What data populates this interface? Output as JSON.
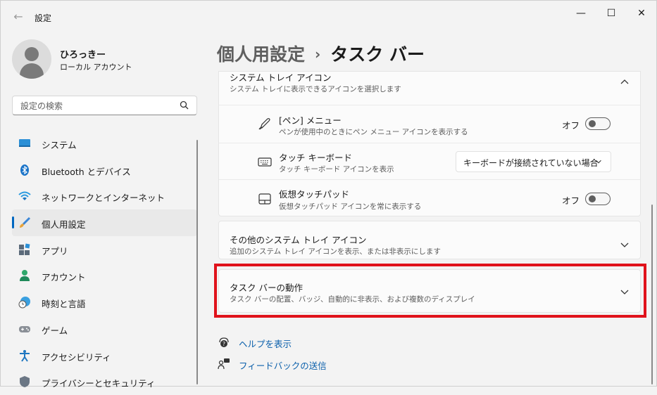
{
  "window": {
    "title": "設定",
    "back_glyph": "←",
    "minimize_glyph": "—",
    "maximize_glyph": "☐",
    "close_glyph": "✕"
  },
  "profile": {
    "name": "ひろっきー",
    "account_type": "ローカル アカウント"
  },
  "search": {
    "placeholder": "設定の検索"
  },
  "nav": {
    "items": [
      {
        "label": "システム",
        "icon": "system-icon"
      },
      {
        "label": "Bluetooth とデバイス",
        "icon": "bluetooth-icon"
      },
      {
        "label": "ネットワークとインターネット",
        "icon": "wifi-icon"
      },
      {
        "label": "個人用設定",
        "icon": "brush-icon",
        "selected": true
      },
      {
        "label": "アプリ",
        "icon": "apps-icon"
      },
      {
        "label": "アカウント",
        "icon": "account-icon"
      },
      {
        "label": "時刻と言語",
        "icon": "clock-globe-icon"
      },
      {
        "label": "ゲーム",
        "icon": "gamepad-icon"
      },
      {
        "label": "アクセシビリティ",
        "icon": "accessibility-icon"
      },
      {
        "label": "プライバシーとセキュリティ",
        "icon": "shield-icon"
      }
    ]
  },
  "header": {
    "parent": "個人用設定",
    "separator": "›",
    "current": "タスク バー"
  },
  "system_tray": {
    "title": "システム トレイ アイコン",
    "subtitle": "システム トレイに表示できるアイコンを選択します",
    "rows": [
      {
        "title": "[ペン] メニュー",
        "subtitle": "ペンが使用中のときにペン メニュー アイコンを表示する",
        "control": "toggle",
        "state_label": "オフ",
        "icon": "pen-icon"
      },
      {
        "title": "タッチ キーボード",
        "subtitle": "タッチ キーボード アイコンを表示",
        "control": "dropdown",
        "value": "キーボードが接続されていない場合",
        "icon": "keyboard-icon"
      },
      {
        "title": "仮想タッチパッド",
        "subtitle": "仮想タッチパッド アイコンを常に表示する",
        "control": "toggle",
        "state_label": "オフ",
        "icon": "touchpad-icon"
      }
    ]
  },
  "other_tray": {
    "title": "その他のシステム トレイ アイコン",
    "subtitle": "追加のシステム トレイ アイコンを表示、または非表示にします"
  },
  "taskbar_behavior": {
    "title": "タスク バーの動作",
    "subtitle": "タスク バーの配置、バッジ、自動的に非表示、および複数のディスプレイ"
  },
  "links": {
    "help": "ヘルプを表示",
    "feedback": "フィードバックの送信"
  },
  "colors": {
    "accent": "#0067c0",
    "highlight": "#e0121b",
    "link": "#0a5fab"
  }
}
